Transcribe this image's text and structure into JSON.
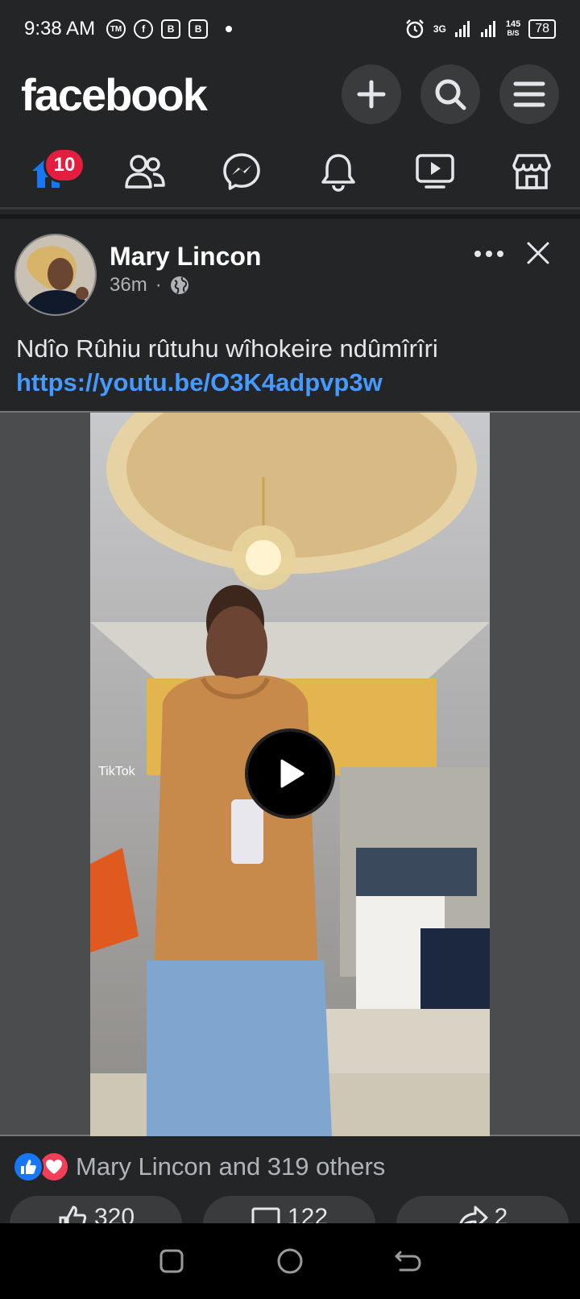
{
  "status_bar": {
    "time": "9:38 AM",
    "left_icons": [
      "TM",
      "f",
      "B",
      "B"
    ],
    "network": "3G",
    "speed_value": "145",
    "speed_unit": "B/S",
    "battery": "78"
  },
  "header": {
    "logo": "facebook",
    "buttons": [
      "plus-icon",
      "search-icon",
      "menu-icon"
    ]
  },
  "nav": {
    "home_badge": "10",
    "tabs": [
      "home-icon",
      "friends-icon",
      "messenger-icon",
      "notifications-icon",
      "watch-icon",
      "marketplace-icon"
    ]
  },
  "post": {
    "author": "Mary Lincon",
    "time": "36m",
    "separator": "·",
    "text": "Ndîo Rûhiu rûtuhu wîhokeire ndûmîrîri",
    "link": "https://youtu.be/O3K4adpvp3w",
    "video_watermark": "TikTok"
  },
  "reactions": {
    "text": "Mary Lincon and 319 others"
  },
  "actions": {
    "like_count": "320",
    "comment_count": "122",
    "share_count": "2"
  },
  "colors": {
    "background": "#242526",
    "accent": "#1877f2",
    "link": "#4599ff",
    "badge": "#e41e3f"
  }
}
